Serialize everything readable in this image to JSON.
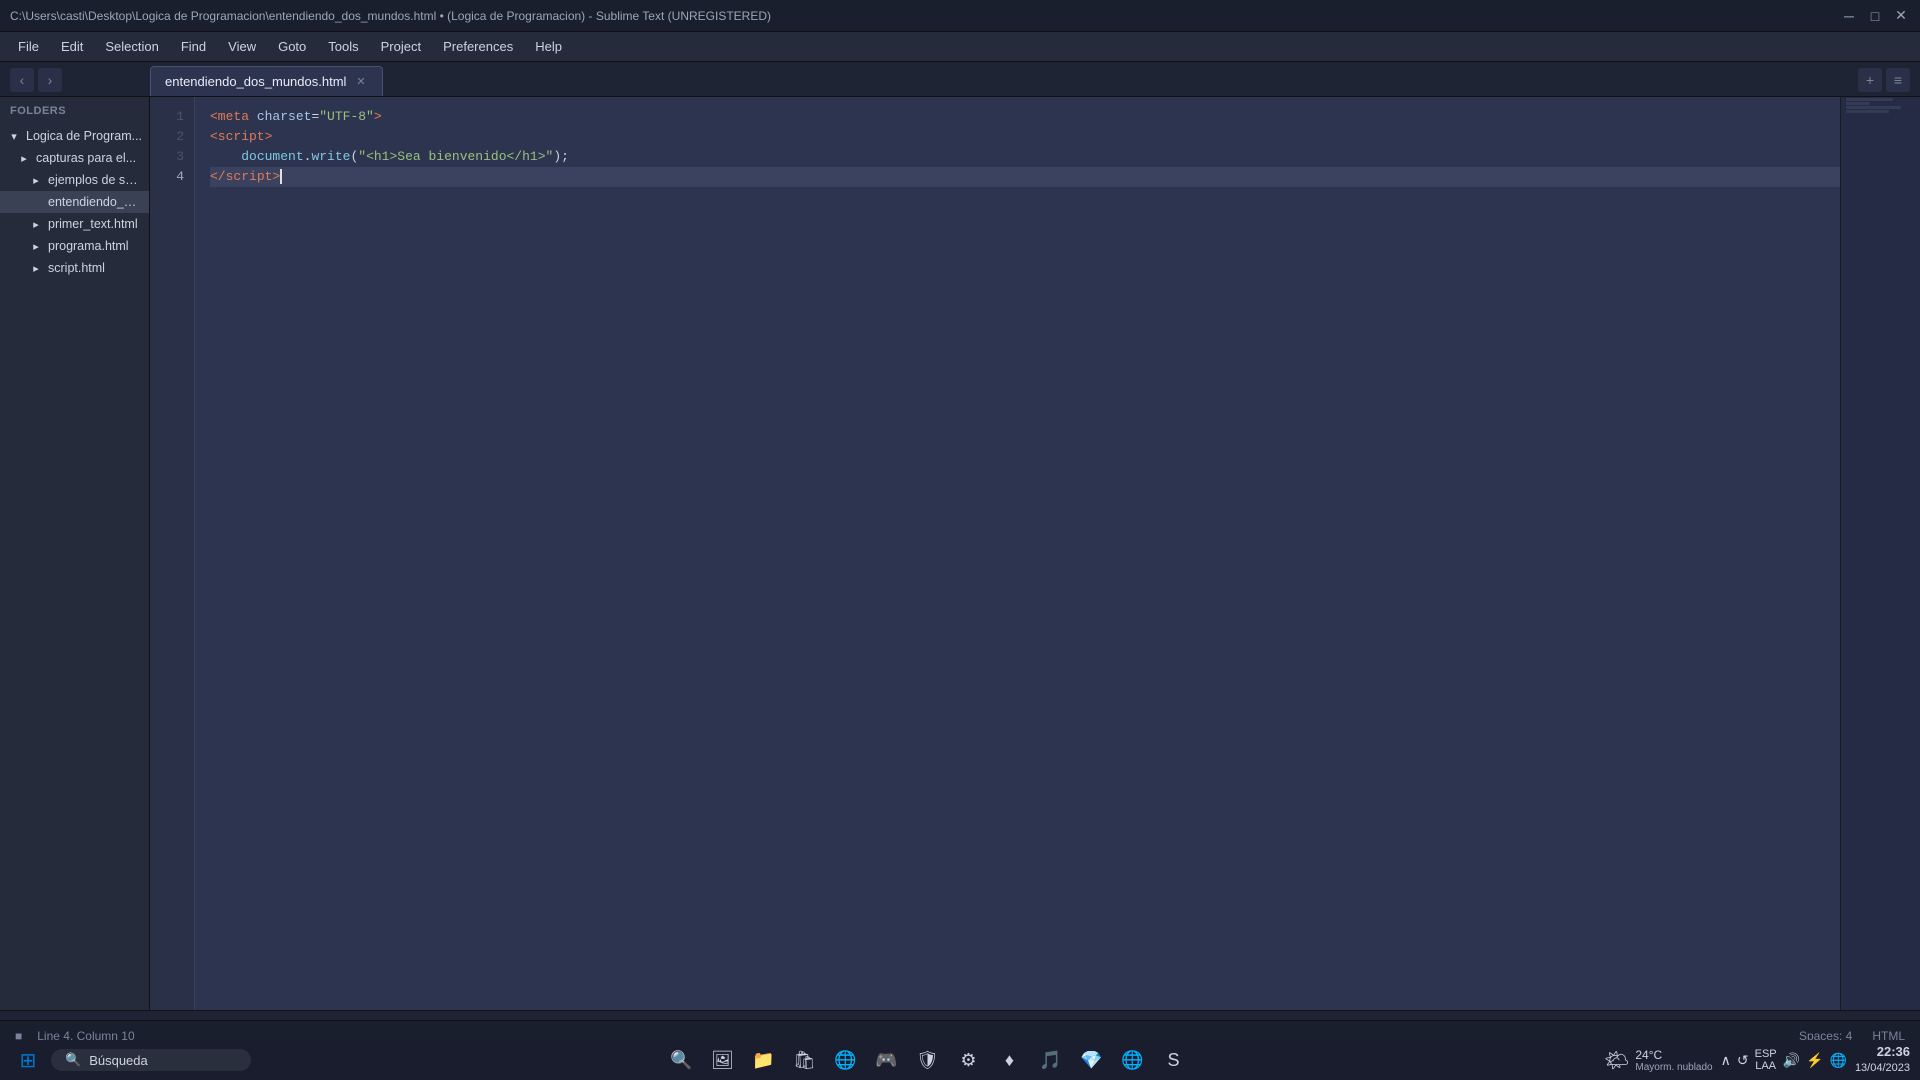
{
  "titlebar": {
    "path": "C:\\Users\\casti\\Desktop\\Logica de Programacion\\entendiendo_dos_mundos.html • (Logica de Programacion) - Sublime Text (UNREGISTERED)",
    "minimize": "─",
    "maximize": "□",
    "close": "✕"
  },
  "menu": {
    "items": [
      "File",
      "Edit",
      "Selection",
      "Find",
      "View",
      "Goto",
      "Tools",
      "Project",
      "Preferences",
      "Help"
    ]
  },
  "tabs": [
    {
      "label": "entendiendo_dos_mundos.html",
      "active": true,
      "modified": false
    }
  ],
  "sidebar": {
    "header": "FOLDERS",
    "items": [
      {
        "level": 0,
        "icon": "▾",
        "arrow": "▾",
        "label": "Logica de Program...",
        "type": "folder",
        "open": true
      },
      {
        "level": 1,
        "icon": "▾",
        "arrow": "▾",
        "label": "capturas para el...",
        "type": "folder",
        "open": false
      },
      {
        "level": 2,
        "icon": "▸",
        "arrow": "▸",
        "label": "ejemplos de scri...",
        "type": "folder"
      },
      {
        "level": 2,
        "icon": "·",
        "arrow": "·",
        "label": "entendiendo_do...",
        "type": "file",
        "selected": true
      },
      {
        "level": 2,
        "icon": "▸",
        "arrow": "▸",
        "label": "primer_text.html",
        "type": "folder"
      },
      {
        "level": 2,
        "icon": "▸",
        "arrow": "▸",
        "label": "programa.html",
        "type": "folder"
      },
      {
        "level": 2,
        "icon": "▸",
        "arrow": "▸",
        "label": "script.html",
        "type": "folder"
      }
    ]
  },
  "editor": {
    "lines": [
      {
        "num": 1,
        "content_parts": [
          {
            "type": "tag",
            "text": "<meta"
          },
          {
            "type": "attr-name",
            "text": " charset"
          },
          {
            "type": "plain",
            "text": "="
          },
          {
            "type": "attr-value",
            "text": "\"UTF-8\""
          },
          {
            "type": "tag",
            "text": ">"
          }
        ]
      },
      {
        "num": 2,
        "content_parts": [
          {
            "type": "tag",
            "text": "<script"
          },
          {
            "type": "tag",
            "text": ">"
          }
        ]
      },
      {
        "num": 3,
        "content_parts": [
          {
            "type": "plain",
            "text": "    "
          },
          {
            "type": "function",
            "text": "document"
          },
          {
            "type": "plain",
            "text": "."
          },
          {
            "type": "function",
            "text": "write"
          },
          {
            "type": "plain",
            "text": "("
          },
          {
            "type": "string",
            "text": "\"<h1>Sea bienvenido</h1>\""
          },
          {
            "type": "plain",
            "text": ");"
          }
        ]
      },
      {
        "num": 4,
        "content_parts": [
          {
            "type": "tag",
            "text": "</"
          },
          {
            "type": "tag",
            "text": "script"
          },
          {
            "type": "tag",
            "text": ">"
          },
          {
            "type": "cursor",
            "text": ""
          }
        ],
        "active": true
      }
    ]
  },
  "statusbar": {
    "left": {
      "indicator": "●",
      "position": "Line 4, Column 10"
    },
    "right": {
      "spaces": "Spaces: 4",
      "syntax": "HTML"
    }
  },
  "taskbar": {
    "weather": {
      "icon": "🌤",
      "temp": "24°C",
      "desc": "Mayorm. nublado"
    },
    "search_placeholder": "Búsqueda",
    "time": "22:36",
    "date": "13/04/2023",
    "language": "ESP",
    "language2": "LAA",
    "apps": [
      {
        "name": "windows-start",
        "icon": "⊞",
        "color": "#0078d4"
      },
      {
        "name": "search",
        "icon": "🔍"
      },
      {
        "name": "landscape",
        "icon": "🖼"
      },
      {
        "name": "files",
        "icon": "📁"
      },
      {
        "name": "store",
        "icon": "🛍"
      },
      {
        "name": "edge",
        "icon": "🌐"
      },
      {
        "name": "xbox",
        "icon": "🎮"
      },
      {
        "name": "mcafee",
        "icon": "🛡"
      },
      {
        "name": "app1",
        "icon": "⚙"
      },
      {
        "name": "app2",
        "icon": "♦"
      },
      {
        "name": "app3",
        "icon": "🎵"
      },
      {
        "name": "app4",
        "icon": "💎"
      },
      {
        "name": "chrome",
        "icon": "🌐"
      },
      {
        "name": "sublime",
        "icon": "S"
      }
    ],
    "tray_icons": [
      "🔔",
      "🔊",
      "⚡",
      "📶"
    ]
  }
}
